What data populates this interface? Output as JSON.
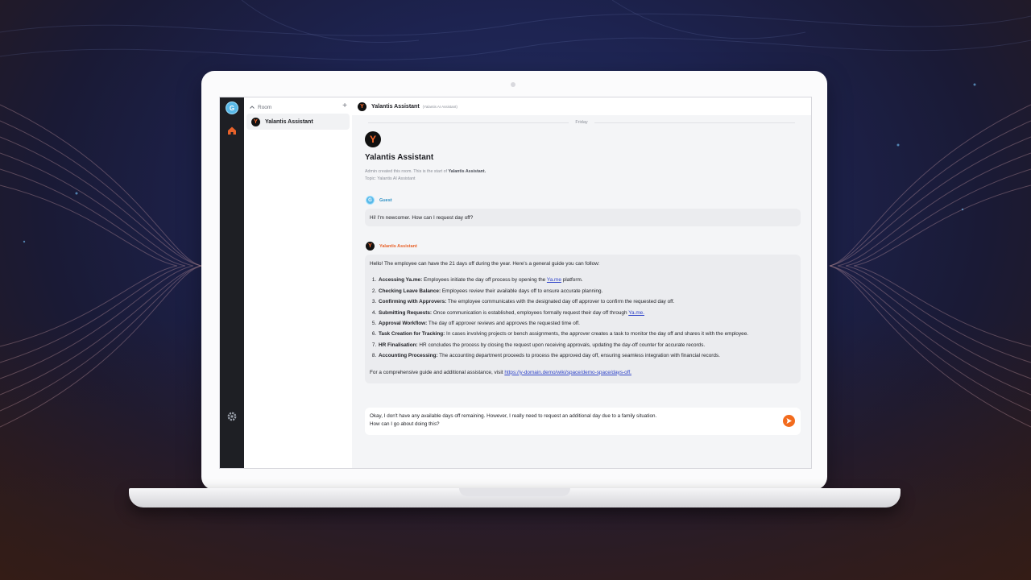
{
  "workspace": {
    "avatar_letter": "G"
  },
  "room_list": {
    "section_label": "Room",
    "rooms": [
      {
        "avatar_letter": "Y",
        "name": "Yalantis Assistant"
      }
    ]
  },
  "chat_header": {
    "avatar_letter": "Y",
    "name": "Yalantis Assistant",
    "topic": "(Yalantis AI Assistant)"
  },
  "timeline": {
    "date_separator": "Friday",
    "intro": {
      "avatar_letter": "Y",
      "title": "Yalantis Assistant",
      "created_prefix": "Admin created this room. This is the start of",
      "created_room": "Yalantis Assistant.",
      "topic_line": "Topic: Yalantis AI Assistant"
    },
    "messages": [
      {
        "sender": "Guest",
        "avatar_letter": "G",
        "text": "Hi! I'm newcomer. How can I request day off?"
      },
      {
        "sender": "Yalantis Assistant",
        "avatar_letter": "Y",
        "intro": "Hello! The employee can have the 21 days off during the year. Here's a general guide you can follow:",
        "steps": [
          {
            "title": "Accessing Ya.me:",
            "text": " Employees initiate the day off process by opening the ",
            "link": "Ya.me",
            "after": " platform."
          },
          {
            "title": "Checking Leave Balance:",
            "text": " Employees review their available days off to ensure accurate planning."
          },
          {
            "title": "Confirming with Approvers:",
            "text": " The employee communicates with the designated day off approver to confirm the requested day off."
          },
          {
            "title": "Submitting Requests:",
            "text": " Once communication is established, employees formally request their day off through ",
            "link": "Ya.me."
          },
          {
            "title": "Approval Workflow:",
            "text": " The day off approver reviews and approves the requested time off."
          },
          {
            "title": "Task Creation for Tracking:",
            "text": " In cases involving projects or bench assignments, the approver creates a task to monitor the day off and shares it with the employee."
          },
          {
            "title": "HR Finalisation:",
            "text": " HR concludes the process by closing the request upon receiving approvals, updating the day-off counter for accurate records."
          },
          {
            "title": "Accounting Processing:",
            "text": " The accounting department proceeds to process the approved day off, ensuring seamless integration with financial records."
          }
        ],
        "footer_prefix": "For a comprehensive guide and additional assistance, visit ",
        "footer_link": "https://y-domain.demo/wiki/space/demo-space/days-off."
      }
    ]
  },
  "composer": {
    "line1": "Okay, I don't have any available days off remaining. However, I really need to request an additional day due to a family situation.",
    "line2": "How can I go about doing this?"
  },
  "icons": {
    "home": "home-icon",
    "settings": "gear-icon",
    "send": "send-icon",
    "add": "plus-icon",
    "collapse": "chevron-icon"
  },
  "colors": {
    "accent": "#f26b1d",
    "guest": "#5ab9e8",
    "link": "#2f44c9"
  }
}
